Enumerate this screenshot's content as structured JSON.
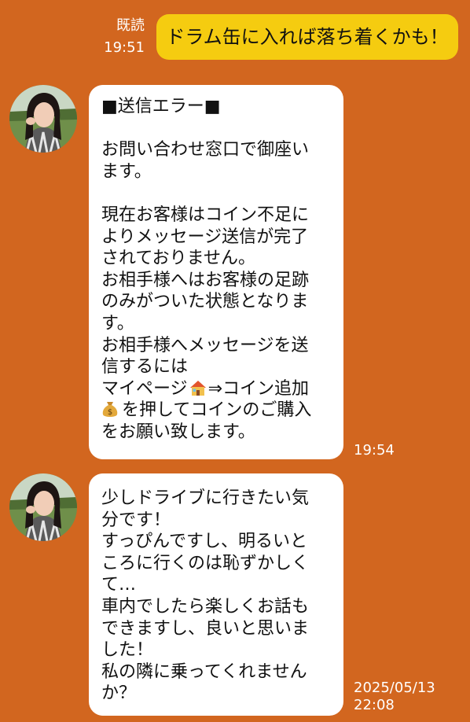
{
  "sent_message": {
    "read_label": "既読",
    "time": "19:51",
    "text": "ドラム缶に入れば落ち着くかも！"
  },
  "messages": [
    {
      "time": "19:54",
      "avatar_icon": "user-avatar",
      "lines": [
        "■送信エラー■",
        "",
        "お問い合わせ窓口で御座い",
        "ます。",
        "",
        "現在お客様はコイン不足に",
        "よりメッセージ送信が完了",
        "されておりません。",
        "お相手様へはお客様の足跡",
        "のみがついた状態となりま",
        "す。",
        "お相手様へメッセージを送",
        "信するには"
      ],
      "line_mypage_a": "マイページ",
      "line_mypage_b": "⇒コイン追加",
      "line_coin": "を押してコインのご購入",
      "line_last": "をお願い致します。",
      "house_icon": "house-icon",
      "money_bag_icon": "money-bag-icon"
    },
    {
      "date": "2025/05/13",
      "time": "22:08",
      "avatar_icon": "user-avatar",
      "lines": [
        "少しドライブに行きたい気",
        "分です！",
        "すっぴんですし、明るいと",
        "ころに行くのは恥ずかしく",
        "て…",
        "車内でしたら楽しくお話も",
        "できますし、良いと思いま",
        "した！",
        "私の隣に乗ってくれません",
        "か？"
      ]
    }
  ],
  "colors": {
    "background": "#d2661f",
    "sent_bubble": "#f5cc10",
    "received_bubble": "#ffffff"
  }
}
